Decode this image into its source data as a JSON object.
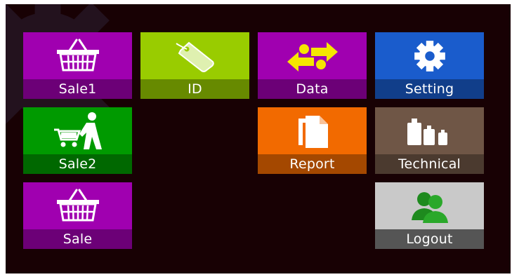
{
  "colors": {
    "background": "#180104",
    "purple": "#a000b0",
    "lime": "#99cc00",
    "blue": "#1a5ccc",
    "green": "#009a00",
    "orange": "#f26a00",
    "brown": "#6f5646",
    "grey": "#c9c9c9"
  },
  "tiles": [
    {
      "label": "Sale1",
      "icon": "basket-icon"
    },
    {
      "label": "ID",
      "icon": "tag-icon"
    },
    {
      "label": "Data",
      "icon": "data-exchange-icon"
    },
    {
      "label": "Setting",
      "icon": "gear-icon"
    },
    {
      "label": "Sale2",
      "icon": "person-cart-icon"
    },
    {
      "label": "Report",
      "icon": "documents-icon"
    },
    {
      "label": "Technical",
      "icon": "weights-icon"
    },
    {
      "label": "Sale",
      "icon": "basket-icon"
    },
    {
      "label": "Logout",
      "icon": "users-icon"
    }
  ]
}
